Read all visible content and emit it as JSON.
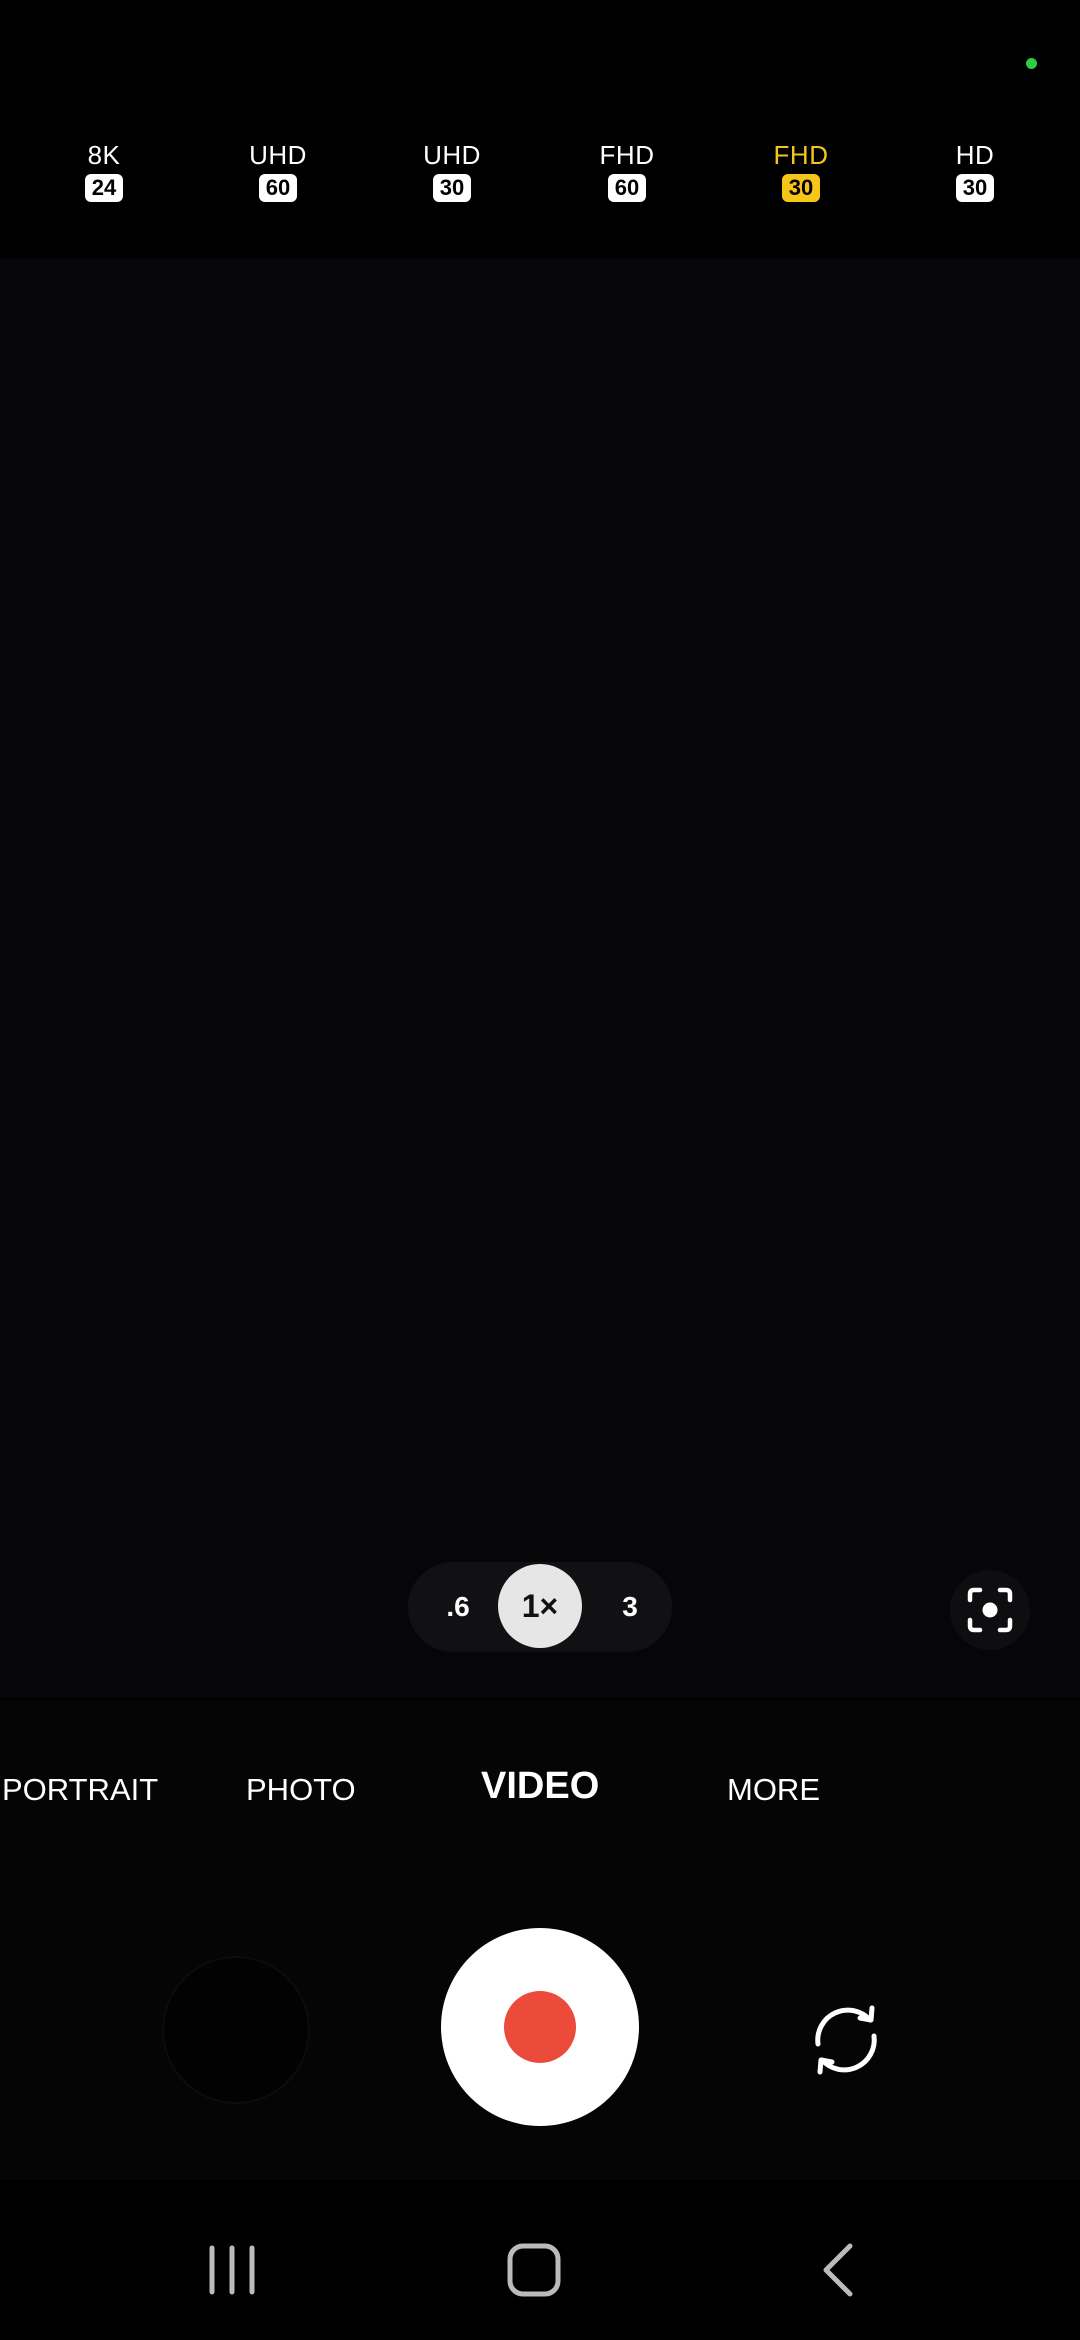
{
  "status": {
    "indicator_color": "#2ecc40"
  },
  "resolutions": [
    {
      "name": "8K",
      "fps": "24",
      "selected": false
    },
    {
      "name": "UHD",
      "fps": "60",
      "selected": false
    },
    {
      "name": "UHD",
      "fps": "30",
      "selected": false
    },
    {
      "name": "FHD",
      "fps": "60",
      "selected": false
    },
    {
      "name": "FHD",
      "fps": "30",
      "selected": true
    },
    {
      "name": "HD",
      "fps": "30",
      "selected": false
    }
  ],
  "zoom": {
    "ultrawide": ".6",
    "current": "1×",
    "tele": "3"
  },
  "modes": {
    "portrait": "PORTRAIT",
    "photo": "PHOTO",
    "video": "VIDEO",
    "more": "MORE",
    "active": "VIDEO"
  },
  "colors": {
    "accent": "#f5c518",
    "record": "#ec4a3a"
  },
  "icons": {
    "focus": "auto-framing-icon",
    "flip": "switch-camera-icon",
    "recents": "recent-apps-icon",
    "home": "home-icon",
    "back": "back-icon"
  }
}
